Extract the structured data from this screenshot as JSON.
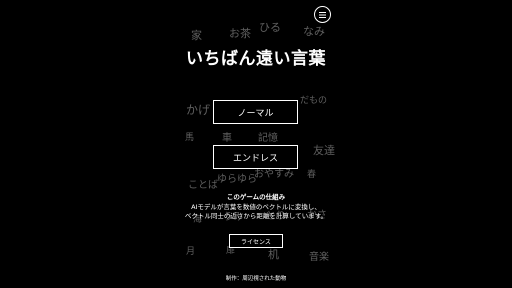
{
  "title": "いちばん遠い言葉",
  "menu_icon": "hamburger-menu-icon",
  "buttons": {
    "normal": "ノーマル",
    "endless": "エンドレス",
    "license": "ライセンス"
  },
  "howto": {
    "title": "このゲームの仕組み",
    "line1": "AIモデルが言葉を数値のベクトルに変換し、",
    "line2": "ベクトル同士の近さから距離を計算しています。"
  },
  "credit": "制作：周辺視された動物",
  "background_words": [
    "家",
    "お茶",
    "ひる",
    "なみ",
    "かげ",
    "だもの",
    "馬",
    "車",
    "記憶",
    "友達",
    "ゆらゆら",
    "おやすみ",
    "春",
    "ことば",
    "海",
    "うみ",
    "とり",
    "かさ",
    "月",
    "扉",
    "机",
    "音楽"
  ],
  "colors": {
    "background": "#000000",
    "foreground": "#ffffff",
    "background_word": "#5f5f5f"
  }
}
